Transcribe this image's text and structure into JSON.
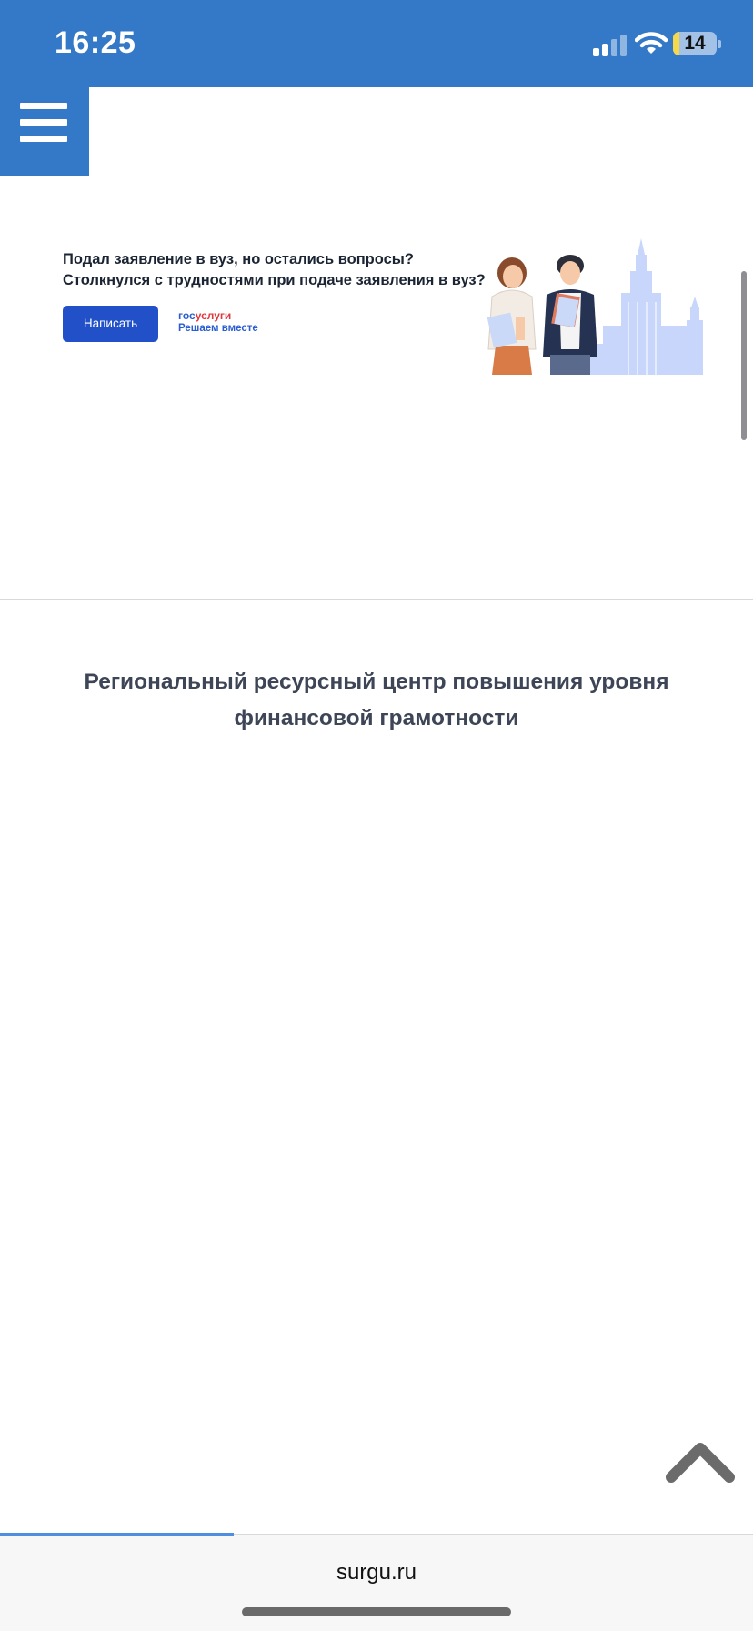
{
  "status_bar": {
    "time": "16:25",
    "battery_level": "14",
    "battery_fraction": 0.14,
    "icons": [
      "cellular-signal-icon",
      "wifi-icon",
      "battery-icon"
    ]
  },
  "menu": {
    "icon": "hamburger-menu-icon"
  },
  "banner": {
    "line1": "Подал заявление в вуз, но остались вопросы?",
    "line2": "Столкнулся с трудностями при подаче заявления в вуз?",
    "button_label": "Написать",
    "logo_part1": "гос",
    "logo_part2": "услуги",
    "logo_tagline": "Решаем вместе"
  },
  "heading": {
    "line1": "Региональный ресурсный центр повышения уровня",
    "line2": "финансовой грамотности"
  },
  "scroll_top": {
    "icon": "chevron-up-icon"
  },
  "browser": {
    "url": "surgu.ru",
    "load_progress": 0.31
  },
  "colors": {
    "header_blue": "#3478c8",
    "button_blue": "#2250c8",
    "gos_blue": "#2a5dd1",
    "gos_red": "#e0373e",
    "heading_text": "#3d4556",
    "battery_yellow": "#f7d84a"
  }
}
